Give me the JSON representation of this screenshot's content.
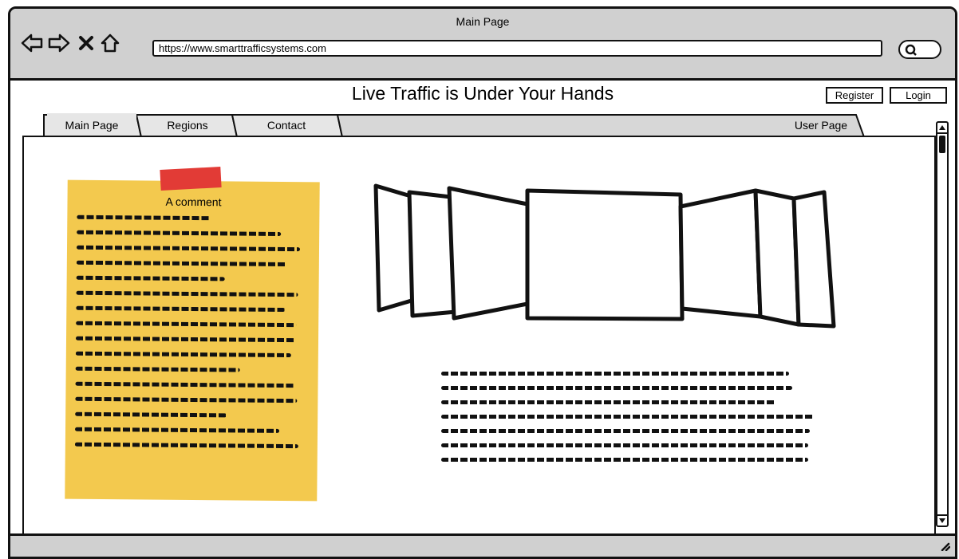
{
  "window": {
    "title": "Main Page"
  },
  "browser": {
    "url": "https://www.smarttrafficsystems.com"
  },
  "header": {
    "headline": "Live Traffic is Under Your Hands",
    "register_label": "Register",
    "login_label": "Login"
  },
  "tabs": [
    {
      "label": "Main Page"
    },
    {
      "label": "Regions"
    },
    {
      "label": "Contact"
    },
    {
      "label": "User Page"
    }
  ],
  "comment": {
    "title": "A comment"
  },
  "icons": [
    "back-arrow-icon",
    "forward-arrow-icon",
    "close-icon",
    "home-icon",
    "search-icon",
    "scroll-up-icon",
    "scroll-down-icon",
    "resize-grip-icon"
  ],
  "colors": {
    "chrome": "#d0d0d0",
    "sticky_note": "#f3c94e",
    "tape": "#e23b36",
    "ink": "#111111"
  }
}
